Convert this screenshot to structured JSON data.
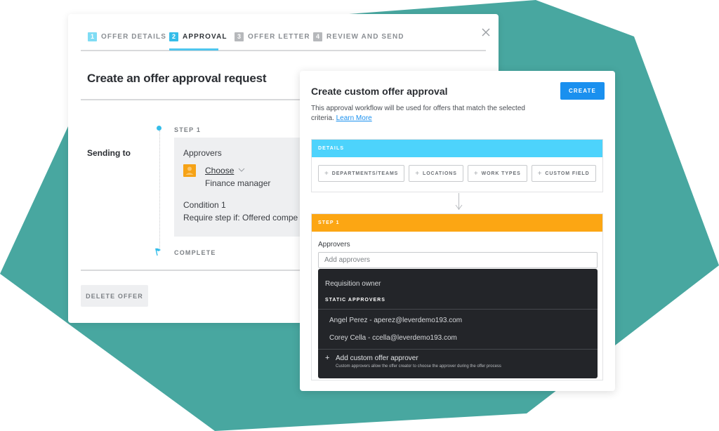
{
  "colors": {
    "background_shape": "#48a7a0",
    "tab_step_1": "#7fdcf4",
    "tab_step_active": "#35bde9",
    "tab_step_inactive": "#b6b8bb",
    "accent_blue": "#1a90ef",
    "details_header": "#4dd3fc",
    "step_header": "#fca613",
    "avatar": "#f6a317",
    "dropdown_bg": "#232529"
  },
  "main_card": {
    "tabs": [
      {
        "number": "1",
        "label": "OFFER DETAILS",
        "state": "completed"
      },
      {
        "number": "2",
        "label": "APPROVAL",
        "state": "active"
      },
      {
        "number": "3",
        "label": "OFFER LETTER",
        "state": "inactive"
      },
      {
        "number": "4",
        "label": "REVIEW AND SEND",
        "state": "inactive"
      }
    ],
    "close_icon": "close-icon",
    "title": "Create an offer approval request",
    "sending_to_label": "Sending to",
    "step_label": "STEP 1",
    "step": {
      "approvers_heading": "Approvers",
      "approver_icon": "user-icon",
      "choose_label": "Choose",
      "approver_role": "Finance manager",
      "condition_title": "Condition 1",
      "condition_text": "Require step if: Offered compe"
    },
    "complete_label": "COMPLETE",
    "delete_button": "DELETE OFFER"
  },
  "panel": {
    "title": "Create custom offer approval",
    "create_button": "CREATE",
    "description": "This approval workflow will be used for offers that match the selected criteria.",
    "learn_more": "Learn More",
    "details_header": "DETAILS",
    "criteria_buttons": [
      {
        "label": "DEPARTMENTS/TEAMS"
      },
      {
        "label": "LOCATIONS"
      },
      {
        "label": "WORK TYPES"
      },
      {
        "label": "CUSTOM FIELD"
      }
    ],
    "step_header": "STEP 1",
    "approvers_label": "Approvers",
    "approvers_placeholder": "Add approvers",
    "dropdown": {
      "requisition_owner": "Requisition owner",
      "static_group_label": "STATIC APPROVERS",
      "static_approvers": [
        "Angel Perez - aperez@leverdemo193.com",
        "Corey Cella - ccella@leverdemo193.com"
      ],
      "add_custom_label": "Add custom offer approver",
      "add_custom_help": "Custom approvers allow the offer creator to choose the approver during the offer process"
    }
  }
}
